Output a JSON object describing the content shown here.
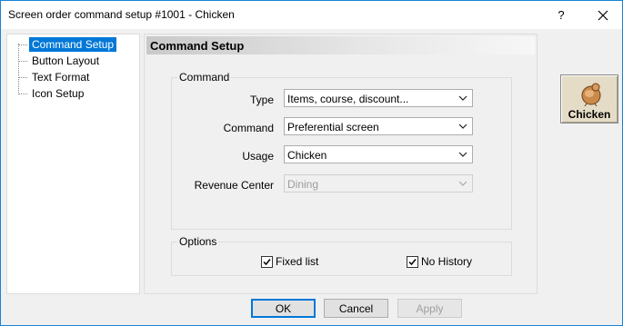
{
  "window": {
    "title": "Screen order command setup #1001 - Chicken",
    "help_label": "?"
  },
  "tree": {
    "items": [
      {
        "label": "Command Setup",
        "selected": true
      },
      {
        "label": "Button Layout",
        "selected": false
      },
      {
        "label": "Text Format",
        "selected": false
      },
      {
        "label": "Icon Setup",
        "selected": false
      }
    ]
  },
  "content": {
    "header": "Command Setup",
    "command_group": {
      "title": "Command",
      "type": {
        "label": "Type",
        "value": "Items, course, discount..."
      },
      "command": {
        "label": "Command",
        "value": "Preferential screen"
      },
      "usage": {
        "label": "Usage",
        "value": "Chicken"
      },
      "revenue_center": {
        "label": "Revenue Center",
        "value": "Dining",
        "disabled": true
      }
    },
    "options_group": {
      "title": "Options",
      "fixed_list": {
        "label": "Fixed list",
        "checked": true
      },
      "no_history": {
        "label": "No History",
        "checked": true
      }
    }
  },
  "preview": {
    "label": "Chicken",
    "icon": "chicken-icon"
  },
  "buttons": {
    "ok": "OK",
    "cancel": "Cancel",
    "apply": "Apply"
  }
}
